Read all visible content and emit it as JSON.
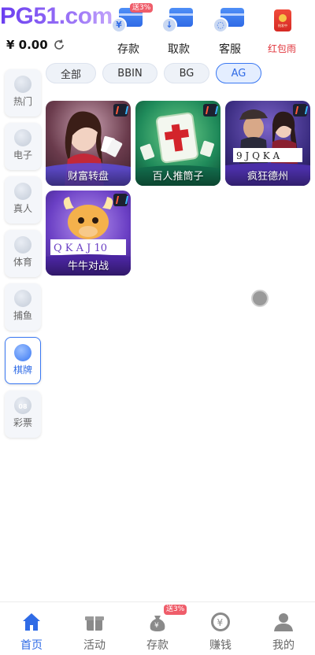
{
  "header": {
    "logo": "PG51.com",
    "balance": "¥ 0.00",
    "actions": [
      {
        "label": "存款",
        "badge": "送3%"
      },
      {
        "label": "取款"
      },
      {
        "label": "客服"
      },
      {
        "label": "红包雨",
        "icon_text": "抢发中"
      }
    ]
  },
  "tabs": [
    {
      "label": "全部"
    },
    {
      "label": "BBIN"
    },
    {
      "label": "BG"
    },
    {
      "label": "AG",
      "active": true
    }
  ],
  "side_nav": [
    {
      "label": "热门"
    },
    {
      "label": "电子"
    },
    {
      "label": "真人"
    },
    {
      "label": "体育"
    },
    {
      "label": "捕鱼"
    },
    {
      "label": "棋牌",
      "active": true
    },
    {
      "label": "彩票",
      "icon_text": "08"
    }
  ],
  "games": [
    {
      "name": "财富转盘"
    },
    {
      "name": "百人推筒子"
    },
    {
      "name": "疯狂德州"
    },
    {
      "name": "牛牛对战"
    }
  ],
  "bottom_nav": [
    {
      "label": "首页",
      "active": true
    },
    {
      "label": "活动"
    },
    {
      "label": "存款",
      "badge": "送3%"
    },
    {
      "label": "赚钱"
    },
    {
      "label": "我的"
    }
  ],
  "colors": {
    "accent": "#2f6be6",
    "badge": "#ef5d6a",
    "logo": "#7a4cf0"
  }
}
